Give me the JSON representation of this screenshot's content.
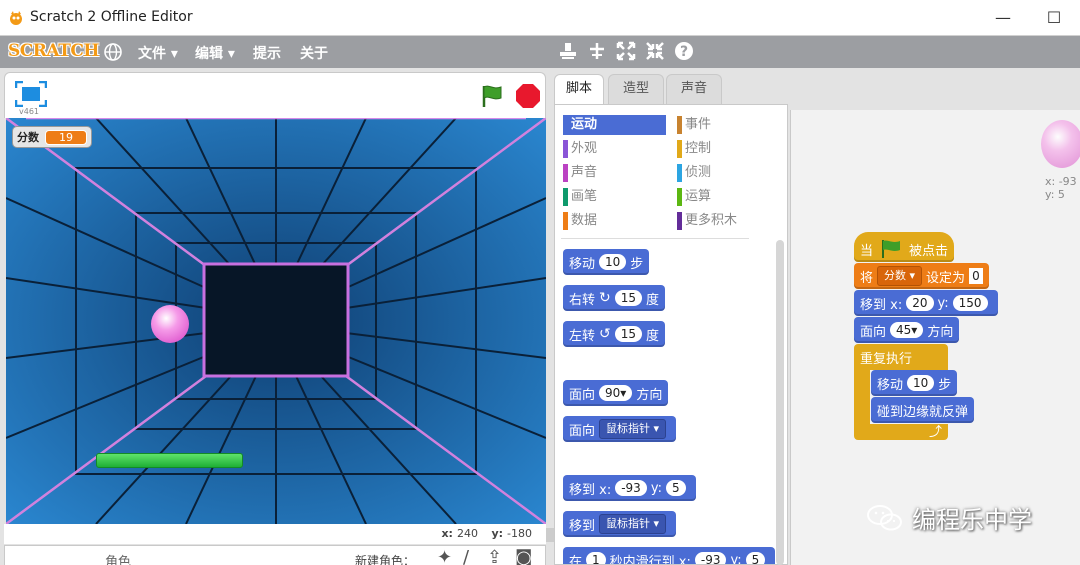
{
  "window": {
    "title": "Scratch 2 Offline Editor",
    "minimize": "—",
    "maximize": "☐"
  },
  "menu": {
    "logo": "SCRATCH",
    "items": [
      "文件 ▾",
      "编辑 ▾",
      "提示",
      "关于"
    ]
  },
  "stage": {
    "version": "v461",
    "monitor": {
      "label": "分数",
      "value": "19"
    },
    "coords": {
      "x_label": "x:",
      "x_value": "240",
      "y_label": "y:",
      "y_value": "-180"
    }
  },
  "sprite_panel": {
    "label": "角色",
    "new_sprite": "新建角色："
  },
  "tabs": [
    "脚本",
    "造型",
    "声音"
  ],
  "categories": [
    {
      "label": "运动",
      "color": "#4a6cd4",
      "active": true
    },
    {
      "label": "事件",
      "color": "#c88330",
      "active": false
    },
    {
      "label": "外观",
      "color": "#8a55d7",
      "active": false
    },
    {
      "label": "控制",
      "color": "#e1a91a",
      "active": false
    },
    {
      "label": "声音",
      "color": "#bb42c3",
      "active": false
    },
    {
      "label": "侦测",
      "color": "#2ca5e2",
      "active": false
    },
    {
      "label": "画笔",
      "color": "#0e9a6c",
      "active": false
    },
    {
      "label": "运算",
      "color": "#5cb712",
      "active": false
    },
    {
      "label": "数据",
      "color": "#ee7d16",
      "active": false
    },
    {
      "label": "更多积木",
      "color": "#632d99",
      "active": false
    }
  ],
  "palette_blocks": {
    "move": {
      "a": "移动",
      "n": "10",
      "b": "步"
    },
    "turn_right": {
      "a": "右转",
      "n": "15",
      "b": "度"
    },
    "turn_left": {
      "a": "左转",
      "n": "15",
      "b": "度"
    },
    "point_dir": {
      "a": "面向",
      "n": "90▾",
      "b": "方向"
    },
    "point_towards": {
      "a": "面向",
      "d": "鼠标指针 ▾"
    },
    "goto_xy": {
      "a": "移到 x:",
      "x": "-93",
      "b": "y:",
      "y": "5"
    },
    "goto": {
      "a": "移到",
      "d": "鼠标指针 ▾"
    },
    "glide": {
      "a": "在",
      "n": "1",
      "b": "秒内滑行到 x:",
      "x": "-93",
      "c": "y:",
      "y": "5"
    }
  },
  "script": {
    "hat": {
      "a": "当",
      "b": "被点击"
    },
    "set_var": {
      "a": "将",
      "d": "分数 ▾",
      "b": "设定为",
      "v": "0"
    },
    "goto": {
      "a": "移到 x:",
      "x": "20",
      "b": "y:",
      "y": "150"
    },
    "dir": {
      "a": "面向",
      "n": "45▾",
      "b": "方向"
    },
    "forever": "重复执行",
    "move": {
      "a": "移动",
      "n": "10",
      "b": "步"
    },
    "bounce": "碰到边缘就反弹",
    "arrow": "⤴"
  },
  "sprite_info": {
    "x": "x: -93",
    "y": "y: 5"
  },
  "watermark": "编程乐中学"
}
